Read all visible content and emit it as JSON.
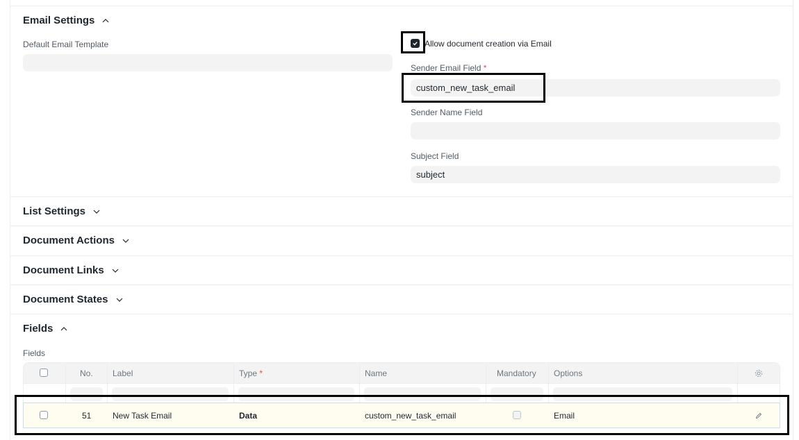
{
  "sections": {
    "email_settings": "Email Settings",
    "list_settings": "List Settings",
    "document_actions": "Document Actions",
    "document_links": "Document Links",
    "document_states": "Document States",
    "fields": "Fields"
  },
  "email": {
    "default_template_label": "Default Email Template",
    "default_template_value": "",
    "allow_creation_label": "Allow document creation via Email",
    "allow_creation_checked": true,
    "sender_email_label": "Sender Email Field",
    "sender_email_value": "custom_new_task_email",
    "sender_name_label": "Sender Name Field",
    "sender_name_value": "",
    "subject_label": "Subject Field",
    "subject_value": "subject",
    "required_mark": "*"
  },
  "fields_table": {
    "title": "Fields",
    "columns": [
      "No.",
      "Label",
      "Type",
      "Name",
      "Mandatory",
      "Options"
    ],
    "type_required_mark": "*",
    "rows": [
      {
        "no": "51",
        "label": "New Task Email",
        "type": "Data",
        "name": "custom_new_task_email",
        "mandatory": false,
        "options": "Email"
      }
    ]
  },
  "icons": [
    "chevron-up-icon",
    "chevron-down-icon",
    "gear-icon",
    "edit-icon",
    "check-icon"
  ]
}
